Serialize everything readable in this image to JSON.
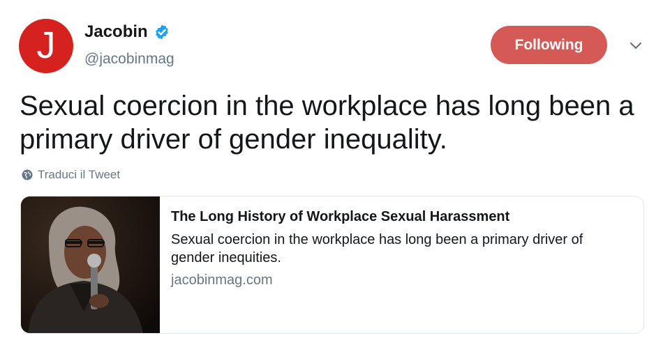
{
  "author": {
    "avatar_letter": "J",
    "name": "Jacobin",
    "handle": "@jacobinmag",
    "verified": true
  },
  "follow_button": {
    "label": "Following"
  },
  "tweet": {
    "text": "Sexual coercion in the workplace has long been a primary driver of gender inequality.",
    "translate_label": "Traduci il Tweet"
  },
  "card": {
    "title": "The Long History of Workplace Sexual Harassment",
    "description": "Sexual coercion in the workplace has long been a primary driver of gender inequities.",
    "domain": "jacobinmag.com",
    "image": "photo-woman-speaking-into-microphone"
  },
  "colors": {
    "avatar_bg": "#d6221f",
    "follow_bg": "#d55a55",
    "verified": "#1da1f2",
    "secondary_text": "#657786"
  }
}
